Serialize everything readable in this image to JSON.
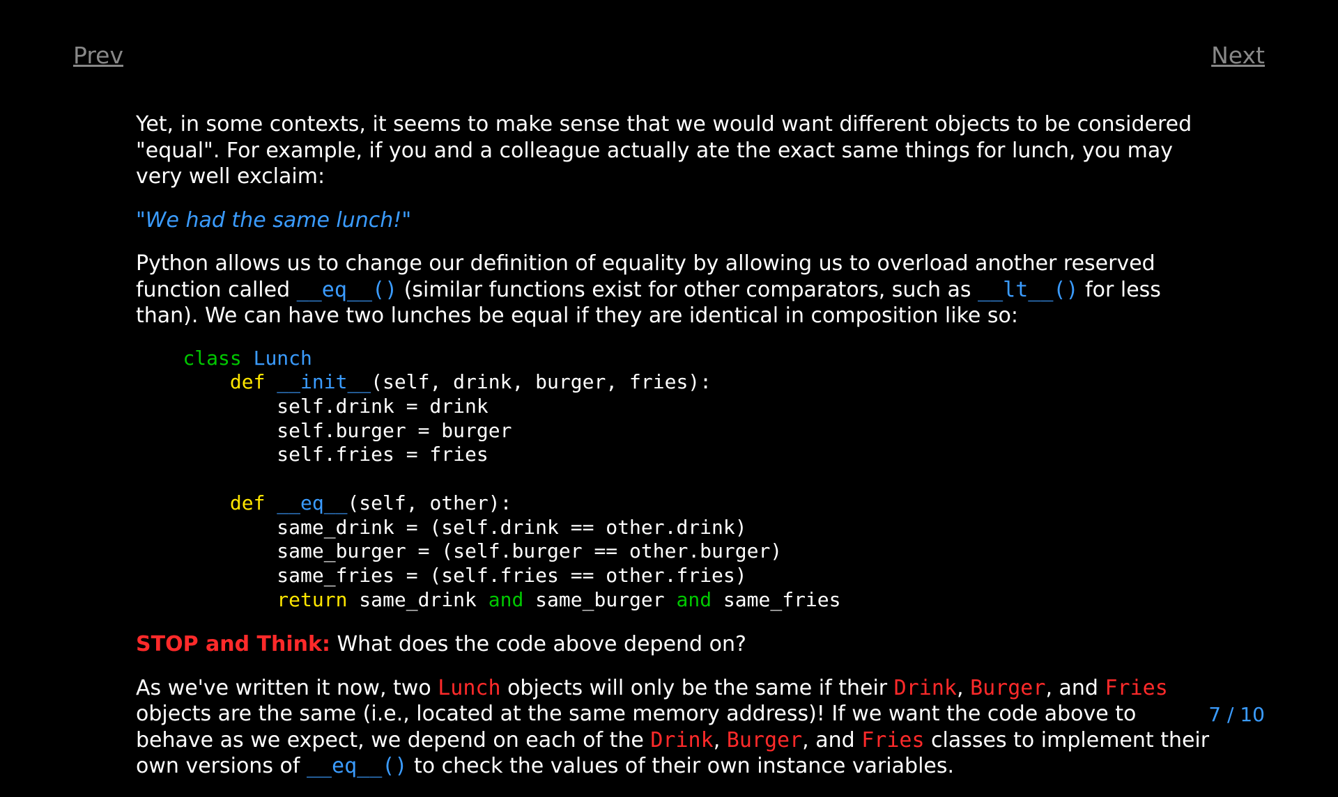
{
  "nav": {
    "prev": "Prev",
    "next": "Next"
  },
  "page": {
    "current": 7,
    "total": 10,
    "sep": " / "
  },
  "p1": "Yet, in some contexts, it seems to make sense that we would want different objects to be considered \"equal\". For example, if you and a colleague actually ate the exact same things for lunch, you may very well exclaim:",
  "quote": "\"We had the same lunch!\"",
  "p2a": "Python allows us to change our definition of equality by allowing us to overload another reserved function called ",
  "eq_tok": "__eq__()",
  "p2b": " (similar functions exist for other comparators, such as ",
  "lt_tok": "__lt__()",
  "p2c": " for less than). We can have two lunches be equal if they are identical in composition like so:",
  "code": {
    "l1a": "    ",
    "l1_class": "class ",
    "l1_name": "Lunch",
    "l2a": "        ",
    "def": "def ",
    "l2_init": "__init__",
    "l2_sig": "(self, drink, burger, fries):",
    "l3": "            self.drink = drink",
    "l4": "            self.burger = burger",
    "l5": "            self.fries = fries",
    "blank": "",
    "l7a": "        ",
    "l7_eq": "__eq__",
    "l7_sig": "(self, other):",
    "l8": "            same_drink = (self.drink == other.drink)",
    "l9": "            same_burger = (self.burger == other.burger)",
    "l10": "            same_fries = (self.fries == other.fries)",
    "l11a": "            ",
    "ret": "return",
    "l11b": " same_drink ",
    "and": "and",
    "l11c": " same_burger ",
    "l11d": " same_fries"
  },
  "stop_label": "STOP and Think:",
  "stop_rest": " What does the code above depend on?",
  "p3a": "As we've written it now, two ",
  "lunch": "Lunch",
  "p3b": " objects will only be the same if their ",
  "drink": "Drink",
  "comma_sp": ", ",
  "burger": "Burger",
  "and_sp": ", and ",
  "fries": "Fries",
  "p3c": " objects are the same (i.e., located at the same memory address)! If we want the code above to behave as we expect, we depend on each of the ",
  "p3d": " classes to implement their own versions of ",
  "p3e": " to check the values of their own instance variables."
}
